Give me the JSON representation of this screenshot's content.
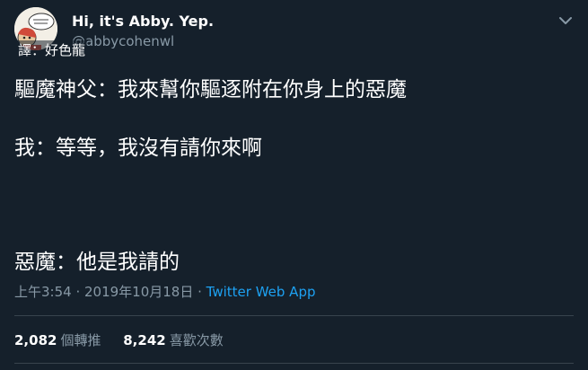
{
  "author": {
    "display_name": "Hi, it's Abby. Yep.",
    "handle": "@abbycohenwl"
  },
  "translator_note": "譯：好色龍",
  "tweet": {
    "lines": [
      "驅魔神父：我來幫你驅逐附在你身上的惡魔",
      "我：等等，我沒有請你來啊",
      "惡魔：他是我請的"
    ]
  },
  "meta": {
    "time": "上午3:54",
    "separator_1": " · ",
    "date": "2019年10月18日",
    "separator_2": " · ",
    "source": "Twitter Web App"
  },
  "stats": {
    "retweets": {
      "count": "2,082",
      "label": "個轉推"
    },
    "likes": {
      "count": "8,242",
      "label": "喜歡次數"
    }
  },
  "icons": {
    "avatar": "avatar-illustration",
    "menu": "chevron-down-icon"
  },
  "colors": {
    "background": "#15202b",
    "text": "#ffffff",
    "secondary_text": "#8899a6",
    "link": "#1da1f2",
    "divider": "#38444d"
  }
}
